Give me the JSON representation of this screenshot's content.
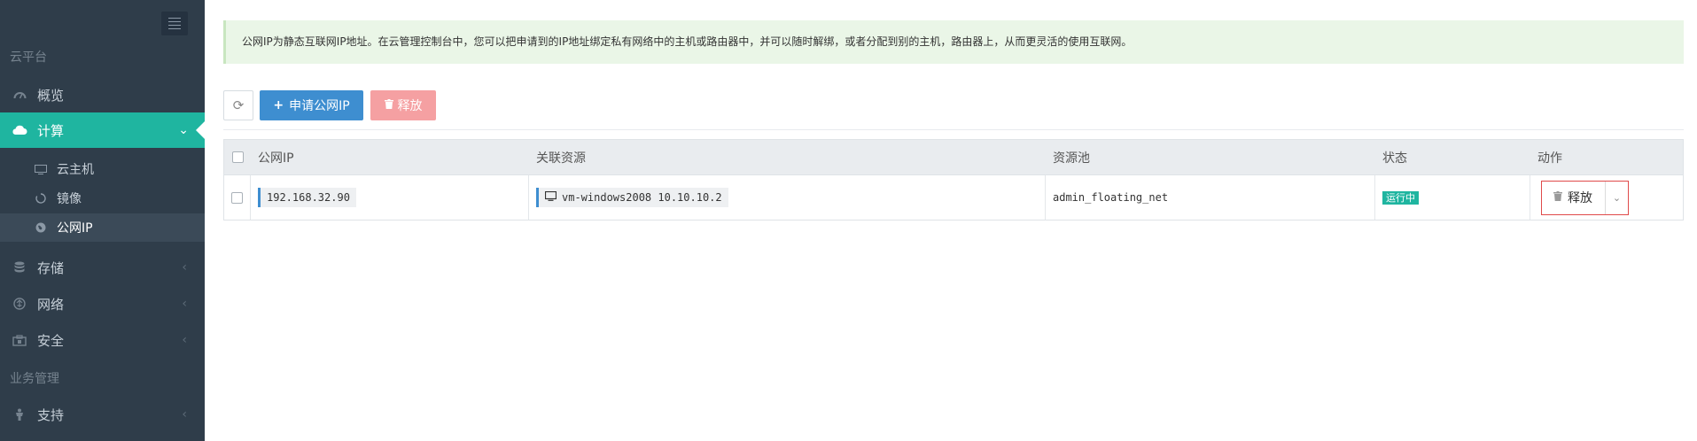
{
  "sidebar": {
    "section_cloud": "云平台",
    "overview": "概览",
    "compute": "计算",
    "compute_sub": [
      "云主机",
      "镜像",
      "公网IP"
    ],
    "storage": "存储",
    "network": "网络",
    "security": "安全",
    "section_business": "业务管理",
    "support": "支持"
  },
  "notice": "公网IP为静态互联网IP地址。在云管理控制台中，您可以把申请到的IP地址绑定私有网络中的主机或路由器中，并可以随时解绑，或者分配到别的主机，路由器上，从而更灵活的使用互联网。",
  "toolbar": {
    "apply_label": "申请公网IP",
    "release_label": "释放"
  },
  "table": {
    "headers": [
      "公网IP",
      "关联资源",
      "资源池",
      "状态",
      "动作"
    ],
    "rows": [
      {
        "ip": "192.168.32.90",
        "resource": "vm-windows2008 10.10.10.2",
        "pool": "admin_floating_net",
        "status": "运行中",
        "action": "释放"
      }
    ]
  },
  "colors": {
    "sidebar_bg": "#2f3d4a",
    "active": "#1fb5a0",
    "primary": "#3e8ed0",
    "danger_light": "#f5a0a2",
    "notice_bg": "#eaf6e7"
  }
}
